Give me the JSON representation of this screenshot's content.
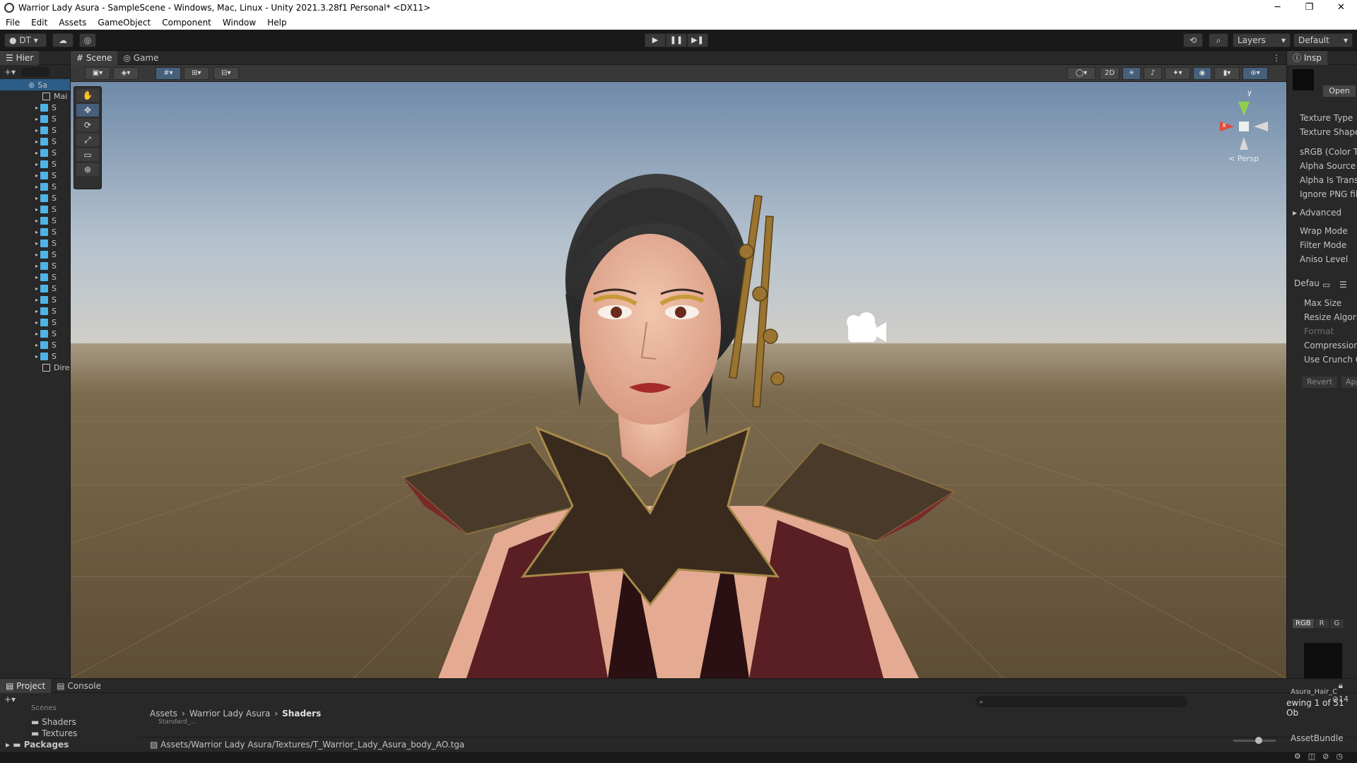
{
  "window": {
    "title": "Warrior Lady Asura - SampleScene - Windows, Mac, Linux - Unity 2021.3.28f1 Personal* <DX11>",
    "minimize": "─",
    "maximize": "❐",
    "close": "✕"
  },
  "menu": [
    "File",
    "Edit",
    "Assets",
    "GameObject",
    "Component",
    "Window",
    "Help"
  ],
  "toolbar": {
    "account": "DT",
    "layers": "Layers",
    "layout": "Default",
    "play": "▶",
    "pause": "❚❚",
    "step": "▶❚"
  },
  "hierarchy": {
    "tab": "Hier",
    "scene_root": "Sa",
    "first_item": "Mai",
    "item_label": "S",
    "last_item": "Dire",
    "cube_count": 23
  },
  "scene_tabs": {
    "scene": "Scene",
    "game": "Game"
  },
  "scene_toolbar": {
    "mode_2d": "2D"
  },
  "gizmo": {
    "persp": "< Persp",
    "x": "x",
    "y": "y"
  },
  "inspector": {
    "tab": "Insp",
    "open": "Open",
    "rows": [
      "Texture Type",
      "Texture Shape",
      "sRGB (Color T",
      "Alpha Source",
      "Alpha Is Trans",
      "Ignore PNG file",
      "Advanced",
      "Wrap Mode",
      "Filter Mode",
      "Aniso Level"
    ],
    "platform": "Defau",
    "platform_rows": [
      "Max Size",
      "Resize Algori",
      "Format",
      "Compression",
      "Use Crunch C"
    ],
    "revert": "Revert",
    "apply": "App",
    "channels": [
      "RGB",
      "R",
      "G"
    ],
    "preview_name": "Asura_Hair_C",
    "viewing": "ewing 1 of 51 Ob",
    "asset_bundle": "AssetBundle"
  },
  "project": {
    "tabs": [
      "Project",
      "Console"
    ],
    "tree": [
      "Scenes",
      "Shaders",
      "Textures",
      "Packages"
    ],
    "breadcrumb": [
      "Assets",
      "Warrior Lady Asura",
      "Shaders"
    ],
    "item_partial": "Standard_...",
    "selected_path": "Assets/Warrior Lady Asura/Textures/T_Warrior_Lady_Asura_body_AO.tga",
    "hidden_count": "14"
  },
  "colors": {
    "accent": "#4fb3e6",
    "sky_top": "#7a93b0",
    "horizon": "#c9c6bf",
    "ground": "#6e5c3f"
  }
}
